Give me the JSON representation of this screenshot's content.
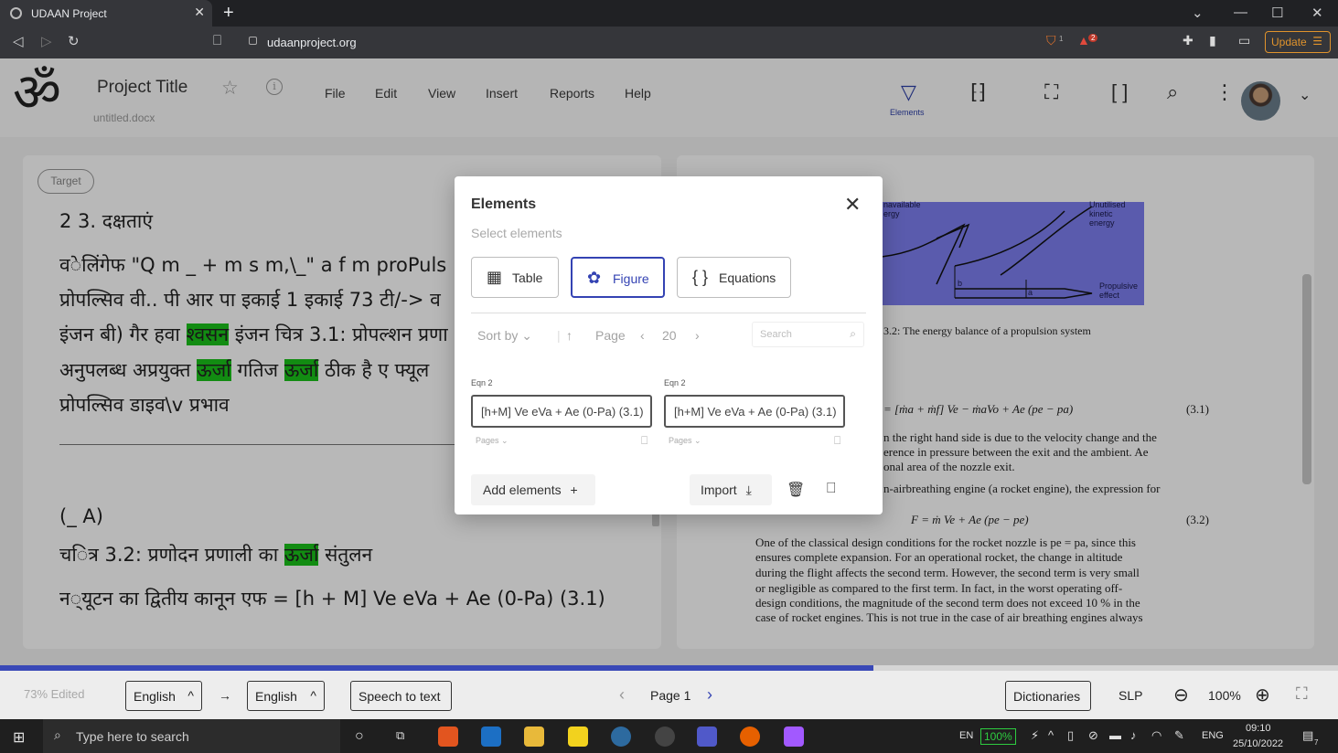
{
  "browser": {
    "tab_title": "UDAAN Project",
    "url": "udaanproject.org",
    "update_label": "Update",
    "brave_badge": "1",
    "alert_badge": "2"
  },
  "header": {
    "logo_glyph": "ॐ",
    "project_title": "Project Title",
    "filename": "untitled.docx",
    "menu": [
      "File",
      "Edit",
      "View",
      "Insert",
      "Reports",
      "Help"
    ],
    "elements_label": "Elements"
  },
  "left_panel": {
    "target_label": "Target",
    "lines": [
      "2 3. दक्षताएं",
      "व◌ेलिंगेफ \"Q m _ + m s m,\\_\" a f m proPuls",
      "प्रोपल्सिव वी.. पी आर पा इकाई 1 इकाई 73 टी/-> व",
      "इंजन बी) गैर हवा ",
      "श्वसन",
      " इंजन चित्र 3.1: प्रोपल्शन प्रणा",
      "अनुपलब्ध अप्रयुक्त ",
      "ऊर्जा",
      " गतिज ",
      "ऊर्जा",
      " ठीक है ए फ्यूल",
      "प्रोपल्सिव डाइव\\v प्रभाव",
      "(_ A)",
      "च◌ित्र 3.2: प्रणोदन प्रणाली का ",
      "ऊर्जा",
      " संतुलन",
      "न◌्यूटन का द्वितीय कानून एफ = [h + M] Ve eVa + Ae (0-Pa) (3.1)"
    ]
  },
  "right_panel": {
    "figure_labels": [
      "navailable\nergy",
      "Unutilised\nkinetic\nenergy",
      "Propulsive\neffect",
      "b",
      "a"
    ],
    "caption": "3.2: The energy balance of a propulsion system",
    "eq1": "= [ṁa + ṁf] Ve − ṁaVo + Ae (pe − pa)",
    "eq1_no": "(3.1)",
    "text1": [
      "n the right hand side is due to the velocity change and the",
      "erence in pressure between the exit and the ambient.  Ae",
      "onal area of the nozzle exit."
    ],
    "text2": "n-airbreathing engine (a rocket engine), the expression for",
    "eq2": "F = ṁ Ve + Ae (pe − pe)",
    "eq2_no": "(3.2)",
    "text3": [
      "One of the classical design conditions for the rocket nozzle is pe = pa, since this",
      "ensures complete expansion.  For an operational rocket, the change in altitude",
      "during the flight affects the second term.  However, the second term is very small",
      "or negligible as compared to the first term.  In fact, in the worst operating off-",
      "design conditions, the magnitude of the second term does not exceed 10 % in the",
      "case of rocket engines.  This is not true in the case of air breathing engines always"
    ]
  },
  "modal": {
    "title": "Elements",
    "subtitle": "Select elements",
    "types": [
      {
        "label": "Table",
        "icon": "table-icon"
      },
      {
        "label": "Figure",
        "icon": "figure-icon"
      },
      {
        "label": "Equations",
        "icon": "braces-icon"
      }
    ],
    "sort_label": "Sort by",
    "page_label": "Page",
    "page_value": "20",
    "search_placeholder": "Search",
    "items": [
      {
        "label": "Eqn 2",
        "value": "[h+M] Ve eVa + Ae (0-Pa) (3.1)",
        "pages": "Pages"
      },
      {
        "label": "Eqn 2",
        "value": "[h+M] Ve eVa + Ae (0-Pa) (3.1)",
        "pages": "Pages"
      }
    ],
    "add_label": "Add elements",
    "import_label": "Import"
  },
  "progress": {
    "fraction": 0.653
  },
  "footer": {
    "edited": "73% Edited",
    "src_lang": "English",
    "tgt_lang": "English",
    "speech": "Speech to text",
    "page": "Page 1",
    "dictionaries": "Dictionaries",
    "slp": "SLP",
    "zoom": "100%"
  },
  "taskbar": {
    "search_placeholder": "Type here to search",
    "lang": "EN",
    "battery": "100%",
    "lang2": "ENG",
    "time": "09:10",
    "date": "25/10/2022",
    "notif_count": "7"
  },
  "colors": {
    "accent": "#3443b3",
    "highlight": "#19c219",
    "update": "#e0932c"
  }
}
